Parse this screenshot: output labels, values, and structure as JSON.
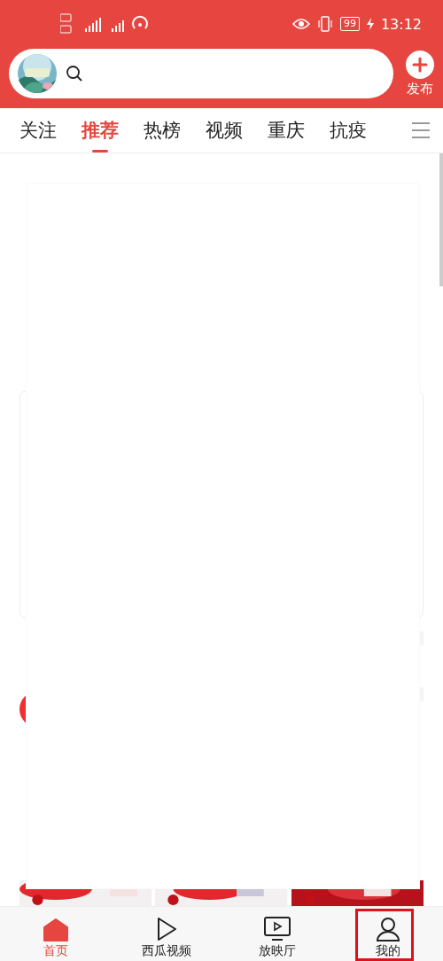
{
  "status_bar": {
    "battery": "99",
    "time": "13:12"
  },
  "header": {
    "publish_label": "发布"
  },
  "tabs": [
    {
      "label": "关注",
      "selected": false
    },
    {
      "label": "推荐",
      "selected": true
    },
    {
      "label": "热榜",
      "selected": false
    },
    {
      "label": "视频",
      "selected": false
    },
    {
      "label": "重庆",
      "selected": false
    },
    {
      "label": "抗疫",
      "selected": false
    }
  ],
  "bottom_nav": [
    {
      "label": "首页",
      "kind": "home",
      "selected": true,
      "highlighted": false
    },
    {
      "label": "西瓜视频",
      "kind": "play",
      "selected": false,
      "highlighted": false
    },
    {
      "label": "放映厅",
      "kind": "tv",
      "selected": false,
      "highlighted": false
    },
    {
      "label": "我的",
      "kind": "person",
      "selected": false,
      "highlighted": true
    }
  ]
}
